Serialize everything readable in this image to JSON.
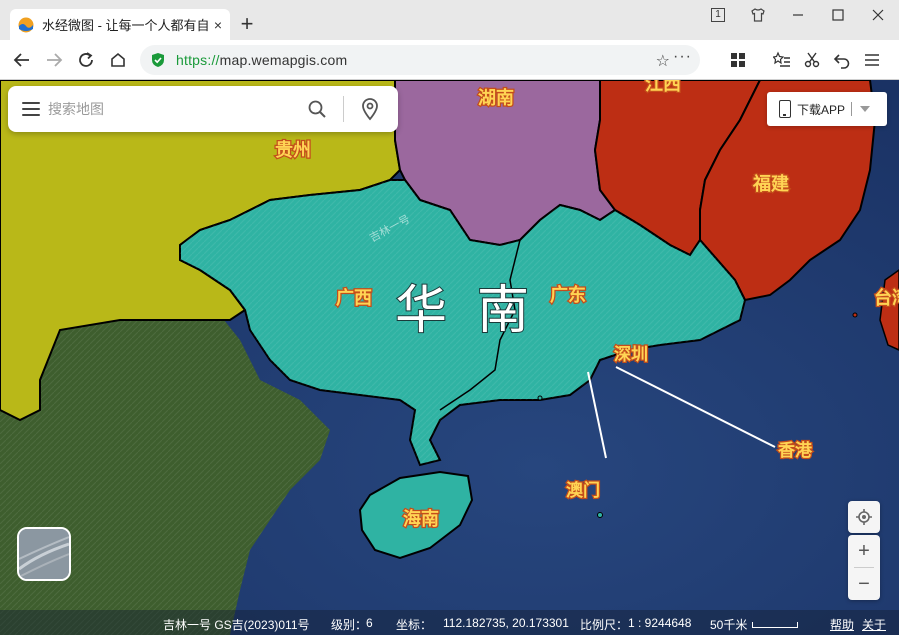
{
  "browser": {
    "tab_title": "水经微图 - 让每一个人都有自",
    "tab_close": "×",
    "new_tab": "+",
    "url_scheme": "https://",
    "url_host": "map.wemapgis.com",
    "window_controls": [
      "1",
      "shirt-icon",
      "minimize",
      "maximize",
      "close"
    ]
  },
  "search": {
    "placeholder": "搜索地图"
  },
  "app_button": {
    "label": "下载APP"
  },
  "map": {
    "region_label": "华南",
    "provinces": {
      "hunan": "湖南",
      "jiangxi": "江西",
      "guizhou": "贵州",
      "fujian": "福建",
      "guangxi": "广西",
      "guangdong": "广东",
      "hainan": "海南",
      "taiwan": "台湾"
    },
    "cities": {
      "shenzhen": "深圳",
      "hongkong": "香港",
      "macau": "澳门"
    },
    "satellite_label": "吉林一号",
    "colors": {
      "hunan": "#9c6a9f",
      "jiangxi": "#bd2e14",
      "fujian": "#bd2e14",
      "guizhou": "#b8b81a",
      "guangxi_guangdong": "#2fb3a3",
      "hainan": "#2fb3a3",
      "sea": "#1f3a6e",
      "land": "#3f5e2f"
    }
  },
  "controls": {
    "locate": "locate-icon",
    "zoom_in": "+",
    "zoom_out": "−"
  },
  "status": {
    "source": "吉林一号 GS吉(2023)011号",
    "level_label": "级别：",
    "level_value": "6",
    "coord_label": "坐标：",
    "coord_value": "112.182735, 20.173301",
    "scale_label": "比例尺：",
    "scale_value": "1 : 9244648",
    "scale_bar": "50千米",
    "help": "帮助",
    "about": "关于"
  }
}
